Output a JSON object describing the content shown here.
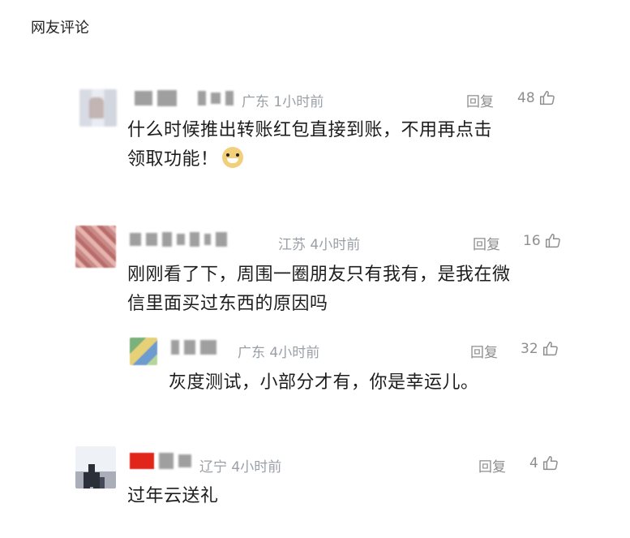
{
  "page_title": "网友评论",
  "comments": [
    {
      "region_time": "广东 1小时前",
      "reply_label": "回复",
      "likes": "48",
      "text_line1": "什么时候推出转账红包直接到账，不用再点击",
      "text_line2": "领取功能！",
      "emoji": "doge-emoji"
    },
    {
      "region_time": "江苏 4小时前",
      "reply_label": "回复",
      "likes": "16",
      "text_line1": "刚刚看了下，周围一圈朋友只有我有，是我在微",
      "text_line2": "信里面买过东西的原因吗"
    },
    {
      "region_time": "广东 4小时前",
      "reply_label": "回复",
      "likes": "32",
      "text_line1": "灰度测试，小部分才有，你是幸运儿。"
    },
    {
      "region_time": "辽宁 4小时前",
      "reply_label": "回复",
      "likes": "4",
      "text_line1": "过年云送礼"
    }
  ],
  "icons": {
    "like": "thumbs-up-icon"
  },
  "colors": {
    "meta_gray": "#9aa0a6",
    "text": "#1d1d1d"
  }
}
